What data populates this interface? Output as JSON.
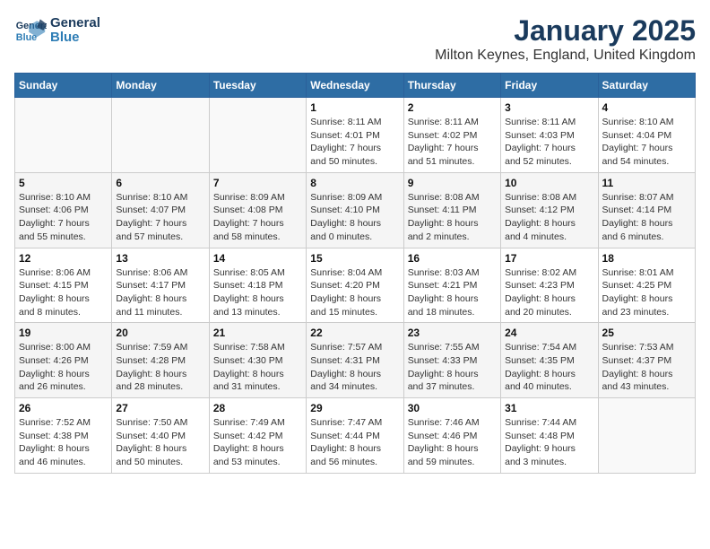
{
  "logo": {
    "line1": "General",
    "line2": "Blue"
  },
  "title": "January 2025",
  "location": "Milton Keynes, England, United Kingdom",
  "weekdays": [
    "Sunday",
    "Monday",
    "Tuesday",
    "Wednesday",
    "Thursday",
    "Friday",
    "Saturday"
  ],
  "weeks": [
    [
      {
        "day": "",
        "info": ""
      },
      {
        "day": "",
        "info": ""
      },
      {
        "day": "",
        "info": ""
      },
      {
        "day": "1",
        "info": "Sunrise: 8:11 AM\nSunset: 4:01 PM\nDaylight: 7 hours\nand 50 minutes."
      },
      {
        "day": "2",
        "info": "Sunrise: 8:11 AM\nSunset: 4:02 PM\nDaylight: 7 hours\nand 51 minutes."
      },
      {
        "day": "3",
        "info": "Sunrise: 8:11 AM\nSunset: 4:03 PM\nDaylight: 7 hours\nand 52 minutes."
      },
      {
        "day": "4",
        "info": "Sunrise: 8:10 AM\nSunset: 4:04 PM\nDaylight: 7 hours\nand 54 minutes."
      }
    ],
    [
      {
        "day": "5",
        "info": "Sunrise: 8:10 AM\nSunset: 4:06 PM\nDaylight: 7 hours\nand 55 minutes."
      },
      {
        "day": "6",
        "info": "Sunrise: 8:10 AM\nSunset: 4:07 PM\nDaylight: 7 hours\nand 57 minutes."
      },
      {
        "day": "7",
        "info": "Sunrise: 8:09 AM\nSunset: 4:08 PM\nDaylight: 7 hours\nand 58 minutes."
      },
      {
        "day": "8",
        "info": "Sunrise: 8:09 AM\nSunset: 4:10 PM\nDaylight: 8 hours\nand 0 minutes."
      },
      {
        "day": "9",
        "info": "Sunrise: 8:08 AM\nSunset: 4:11 PM\nDaylight: 8 hours\nand 2 minutes."
      },
      {
        "day": "10",
        "info": "Sunrise: 8:08 AM\nSunset: 4:12 PM\nDaylight: 8 hours\nand 4 minutes."
      },
      {
        "day": "11",
        "info": "Sunrise: 8:07 AM\nSunset: 4:14 PM\nDaylight: 8 hours\nand 6 minutes."
      }
    ],
    [
      {
        "day": "12",
        "info": "Sunrise: 8:06 AM\nSunset: 4:15 PM\nDaylight: 8 hours\nand 8 minutes."
      },
      {
        "day": "13",
        "info": "Sunrise: 8:06 AM\nSunset: 4:17 PM\nDaylight: 8 hours\nand 11 minutes."
      },
      {
        "day": "14",
        "info": "Sunrise: 8:05 AM\nSunset: 4:18 PM\nDaylight: 8 hours\nand 13 minutes."
      },
      {
        "day": "15",
        "info": "Sunrise: 8:04 AM\nSunset: 4:20 PM\nDaylight: 8 hours\nand 15 minutes."
      },
      {
        "day": "16",
        "info": "Sunrise: 8:03 AM\nSunset: 4:21 PM\nDaylight: 8 hours\nand 18 minutes."
      },
      {
        "day": "17",
        "info": "Sunrise: 8:02 AM\nSunset: 4:23 PM\nDaylight: 8 hours\nand 20 minutes."
      },
      {
        "day": "18",
        "info": "Sunrise: 8:01 AM\nSunset: 4:25 PM\nDaylight: 8 hours\nand 23 minutes."
      }
    ],
    [
      {
        "day": "19",
        "info": "Sunrise: 8:00 AM\nSunset: 4:26 PM\nDaylight: 8 hours\nand 26 minutes."
      },
      {
        "day": "20",
        "info": "Sunrise: 7:59 AM\nSunset: 4:28 PM\nDaylight: 8 hours\nand 28 minutes."
      },
      {
        "day": "21",
        "info": "Sunrise: 7:58 AM\nSunset: 4:30 PM\nDaylight: 8 hours\nand 31 minutes."
      },
      {
        "day": "22",
        "info": "Sunrise: 7:57 AM\nSunset: 4:31 PM\nDaylight: 8 hours\nand 34 minutes."
      },
      {
        "day": "23",
        "info": "Sunrise: 7:55 AM\nSunset: 4:33 PM\nDaylight: 8 hours\nand 37 minutes."
      },
      {
        "day": "24",
        "info": "Sunrise: 7:54 AM\nSunset: 4:35 PM\nDaylight: 8 hours\nand 40 minutes."
      },
      {
        "day": "25",
        "info": "Sunrise: 7:53 AM\nSunset: 4:37 PM\nDaylight: 8 hours\nand 43 minutes."
      }
    ],
    [
      {
        "day": "26",
        "info": "Sunrise: 7:52 AM\nSunset: 4:38 PM\nDaylight: 8 hours\nand 46 minutes."
      },
      {
        "day": "27",
        "info": "Sunrise: 7:50 AM\nSunset: 4:40 PM\nDaylight: 8 hours\nand 50 minutes."
      },
      {
        "day": "28",
        "info": "Sunrise: 7:49 AM\nSunset: 4:42 PM\nDaylight: 8 hours\nand 53 minutes."
      },
      {
        "day": "29",
        "info": "Sunrise: 7:47 AM\nSunset: 4:44 PM\nDaylight: 8 hours\nand 56 minutes."
      },
      {
        "day": "30",
        "info": "Sunrise: 7:46 AM\nSunset: 4:46 PM\nDaylight: 8 hours\nand 59 minutes."
      },
      {
        "day": "31",
        "info": "Sunrise: 7:44 AM\nSunset: 4:48 PM\nDaylight: 9 hours\nand 3 minutes."
      },
      {
        "day": "",
        "info": ""
      }
    ]
  ]
}
